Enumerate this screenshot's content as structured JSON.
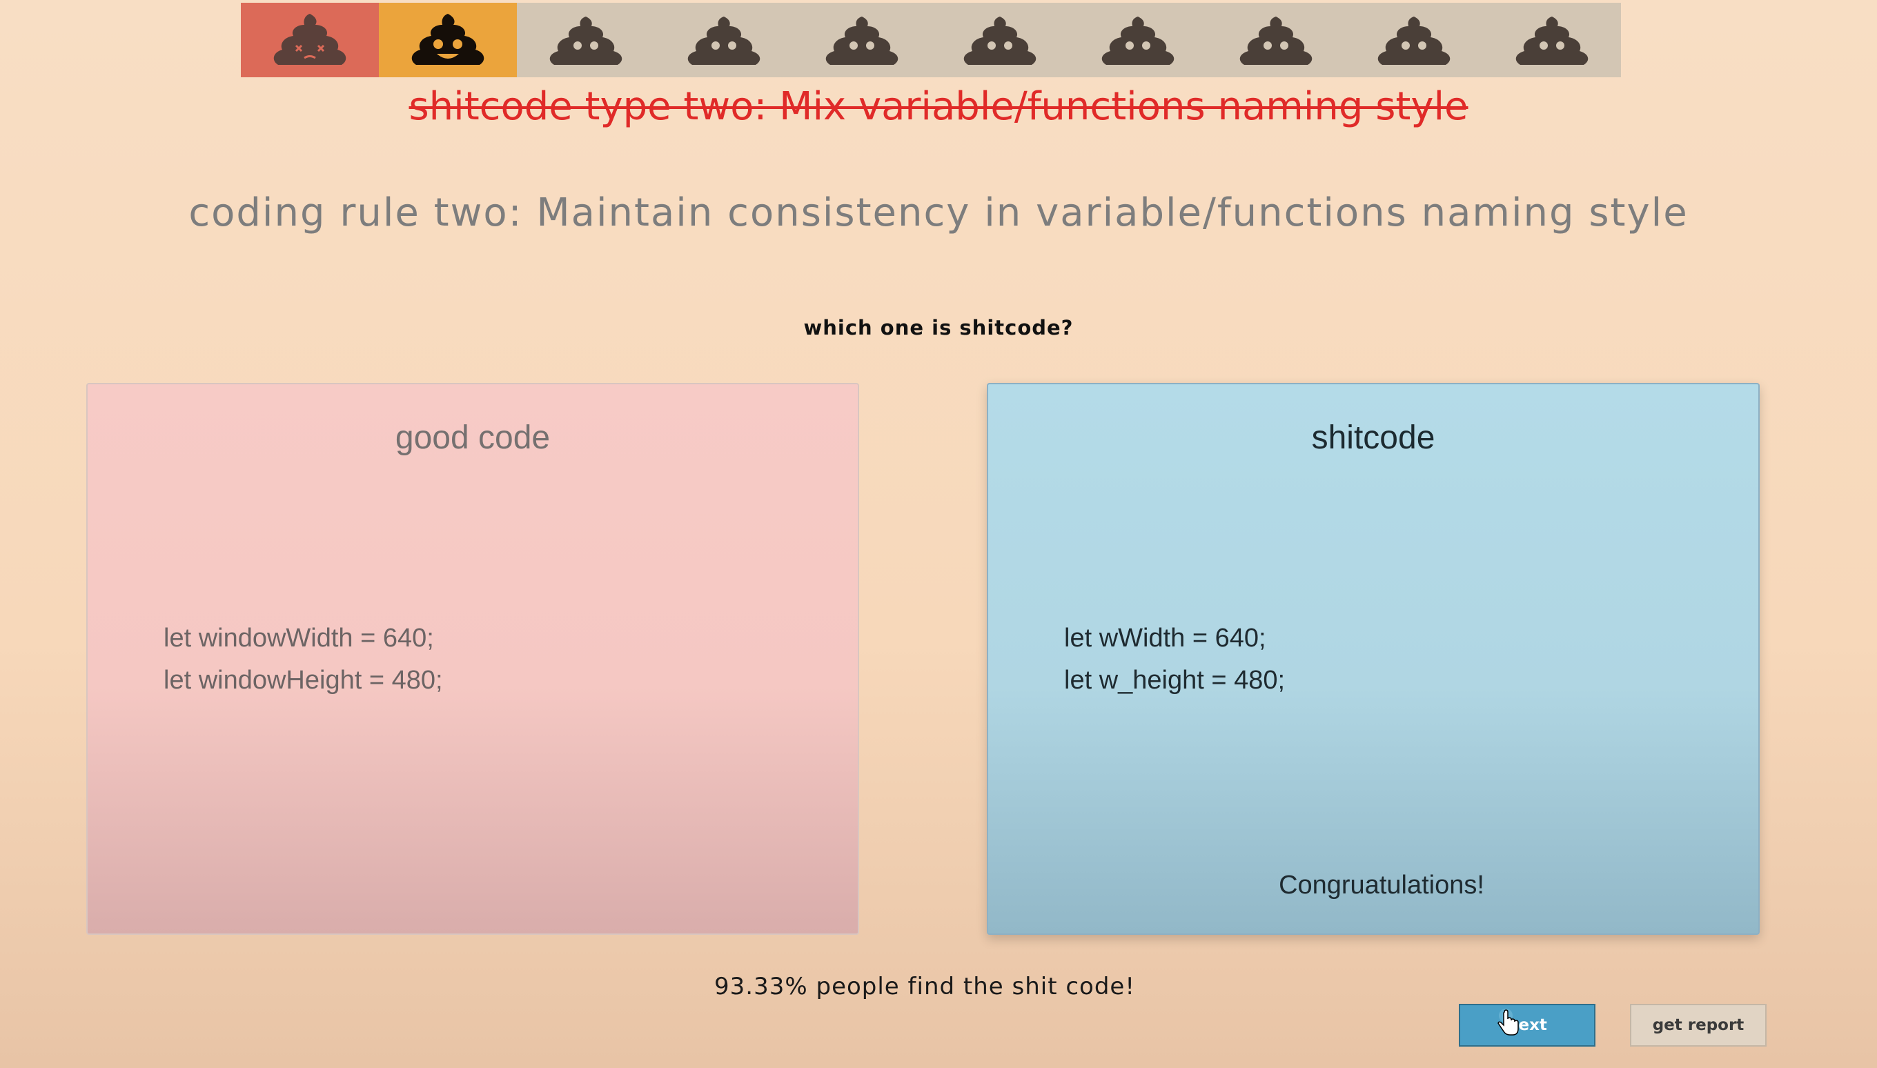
{
  "progress": {
    "items": [
      {
        "state": "failed",
        "icon": "dead-poop-icon"
      },
      {
        "state": "current",
        "icon": "happy-poop-icon"
      },
      {
        "state": "pending",
        "icon": "poop-icon"
      },
      {
        "state": "pending",
        "icon": "poop-icon"
      },
      {
        "state": "pending",
        "icon": "poop-icon"
      },
      {
        "state": "pending",
        "icon": "poop-icon"
      },
      {
        "state": "pending",
        "icon": "poop-icon"
      },
      {
        "state": "pending",
        "icon": "poop-icon"
      },
      {
        "state": "pending",
        "icon": "poop-icon"
      },
      {
        "state": "pending",
        "icon": "poop-icon"
      }
    ],
    "colors": {
      "failed": "#dc6a58",
      "current": "#eba43c",
      "pending": "#d3c6b4"
    }
  },
  "rule": {
    "old_title": "shitcode type two: Mix variable/functions naming style",
    "new_title": "coding rule two: Maintain consistency in variable/functions naming style"
  },
  "question": "which one is shitcode?",
  "cards": {
    "left": {
      "title": "good code",
      "lines": [
        "let windowWidth = 640;",
        "let windowHeight = 480;"
      ]
    },
    "right": {
      "title": "shitcode",
      "lines": [
        "let wWidth = 640;",
        "let w_height = 480;"
      ],
      "message": "Congruatulations!"
    }
  },
  "stats_text": "93.33% people find the shit code!",
  "buttons": {
    "next_label": "next",
    "report_label": "get report"
  }
}
